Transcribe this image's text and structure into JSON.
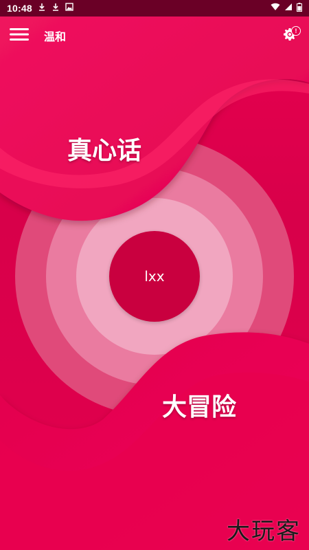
{
  "status_bar": {
    "time": "10:48",
    "left_icons": [
      "download-icon",
      "download-icon",
      "image-icon"
    ],
    "right_icons": [
      "wifi-icon",
      "signal-icon",
      "battery-icon"
    ]
  },
  "app_bar": {
    "title": "温和",
    "menu_icon": "menu-icon",
    "settings_icon": "gear-icon",
    "settings_badge": "!"
  },
  "main": {
    "truth_label": "真心话",
    "center_label": "lxx",
    "dare_label": "大冒险"
  },
  "watermark": "大玩客",
  "colors": {
    "primary": "#e8004f",
    "dark": "#c9003f",
    "status_bar": "#6a0026",
    "ring_outer": "#e04a7a",
    "ring_middle": "#ea7ba0",
    "ring_inner": "#f1a6c0"
  }
}
